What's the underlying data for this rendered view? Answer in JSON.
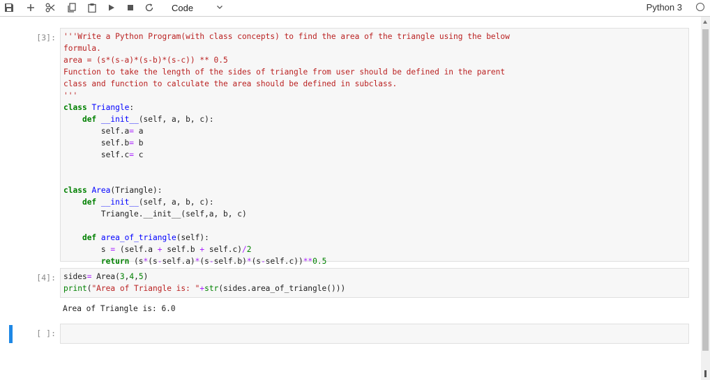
{
  "toolbar": {
    "buttons": [
      {
        "name": "save-icon"
      },
      {
        "name": "add-cell-icon"
      },
      {
        "name": "cut-icon"
      },
      {
        "name": "copy-icon"
      },
      {
        "name": "paste-icon"
      },
      {
        "name": "run-icon"
      },
      {
        "name": "stop-icon"
      },
      {
        "name": "restart-icon"
      }
    ],
    "cell_type": "Code",
    "kernel": "Python 3"
  },
  "cells": [
    {
      "prompt": "[3]:",
      "lines": [
        "'''Write a Python Program(with class concepts) to find the area of the triangle using the below",
        "formula.",
        "area = (s*(s-a)*(s-b)*(s-c)) ** 0.5",
        "Function to take the length of the sides of triangle from user should be defined in the parent",
        "class and function to calculate the area should be defined in subclass.",
        "'''",
        "class Triangle:",
        "    def __init__(self, a, b, c):",
        "        self.a= a",
        "        self.b= b",
        "        self.c= c",
        "",
        "",
        "class Area(Triangle):",
        "    def __init__(self, a, b, c):",
        "        Triangle.__init__(self,a, b, c)",
        "",
        "    def area_of_triangle(self):",
        "        s = (self.a + self.b + self.c)/2",
        "        return (s*(s-self.a)*(s-self.b)*(s-self.c))**0.5"
      ]
    },
    {
      "prompt": "[4]:",
      "lines": [
        "sides= Area(3,4,5)",
        "print(\"Area of Triangle is: \"+str(sides.area_of_triangle()))"
      ],
      "output": "Area of Triangle is: 6.0"
    },
    {
      "prompt": "[ ]:",
      "lines": [
        ""
      ]
    }
  ]
}
